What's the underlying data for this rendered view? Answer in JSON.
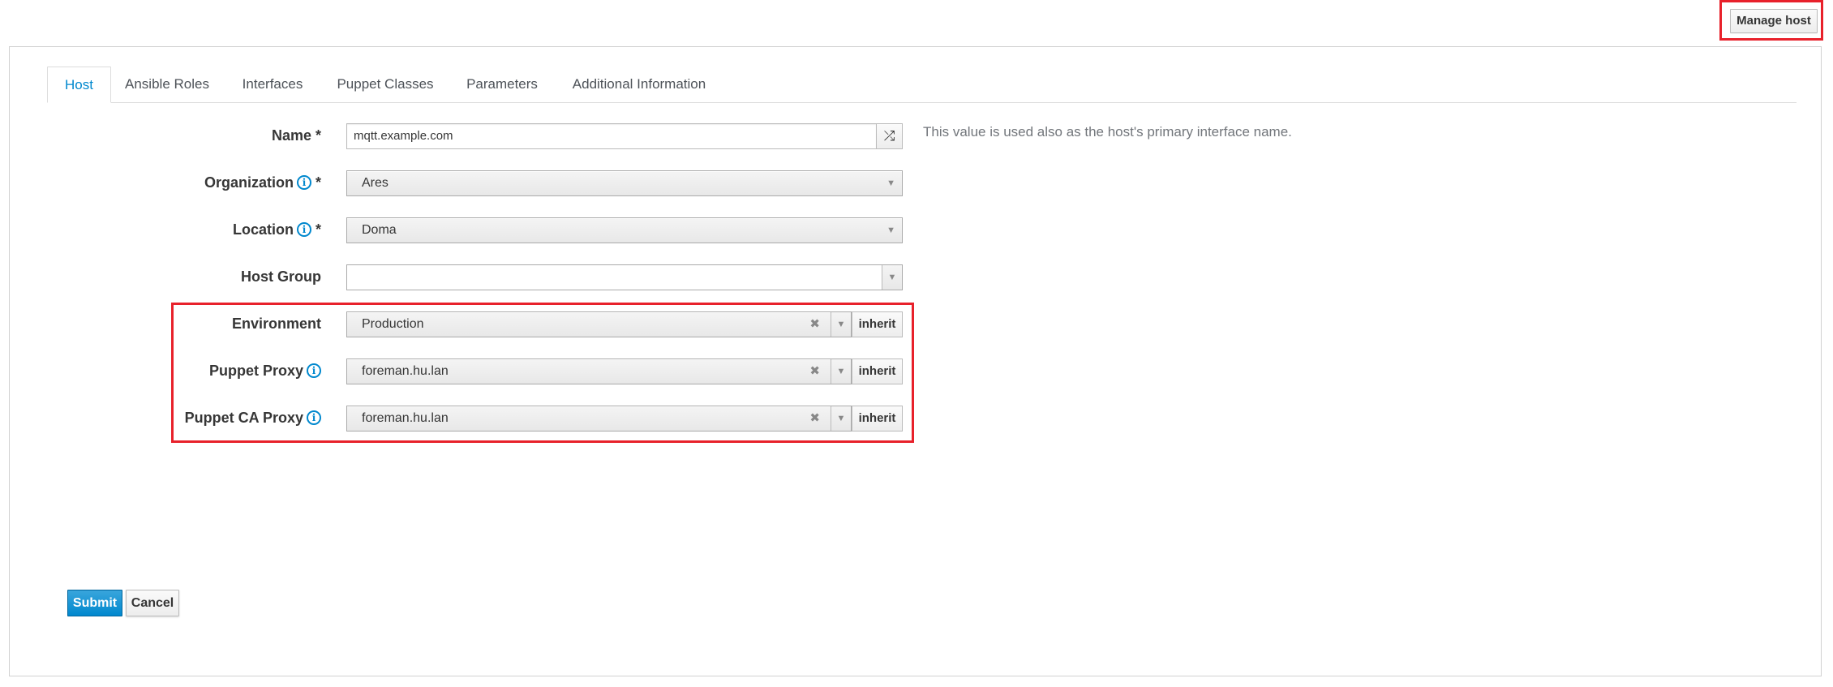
{
  "header": {
    "manage_host_label": "Manage host"
  },
  "tabs": [
    {
      "label": "Host",
      "active": true
    },
    {
      "label": "Ansible Roles"
    },
    {
      "label": "Interfaces"
    },
    {
      "label": "Puppet Classes"
    },
    {
      "label": "Parameters"
    },
    {
      "label": "Additional Information"
    }
  ],
  "form": {
    "name": {
      "label": "Name",
      "required_mark": "*",
      "value": "mqtt.example.com",
      "help": "This value is used also as the host's primary interface name.",
      "randomize_icon": "shuffle-icon"
    },
    "organization": {
      "label": "Organization",
      "required_mark": "*",
      "value": "Ares",
      "info_icon": "info-icon"
    },
    "location": {
      "label": "Location",
      "required_mark": "*",
      "value": "Doma",
      "info_icon": "info-icon"
    },
    "host_group": {
      "label": "Host Group",
      "value": ""
    },
    "environment": {
      "label": "Environment",
      "value": "Production",
      "inherit_label": "inherit"
    },
    "puppet_proxy": {
      "label": "Puppet Proxy",
      "value": "foreman.hu.lan",
      "inherit_label": "inherit",
      "info_icon": "info-icon"
    },
    "puppet_ca_proxy": {
      "label": "Puppet CA Proxy",
      "value": "foreman.hu.lan",
      "inherit_label": "inherit",
      "info_icon": "info-icon"
    }
  },
  "actions": {
    "submit_label": "Submit",
    "cancel_label": "Cancel"
  },
  "colors": {
    "accent": "#0088ce",
    "highlight": "#e8212b"
  }
}
